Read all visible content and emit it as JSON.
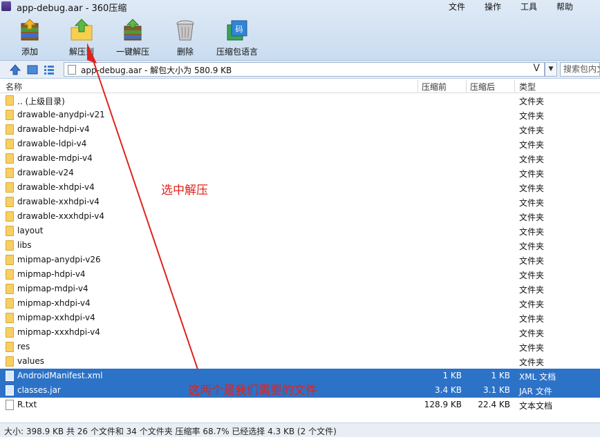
{
  "window": {
    "title": "app-debug.aar - 360压缩",
    "menus": [
      "文件",
      "操作",
      "工具",
      "帮助"
    ]
  },
  "toolbar": [
    {
      "label": "添加",
      "icon": "add-archive-icon"
    },
    {
      "label": "解压到",
      "icon": "extract-to-icon"
    },
    {
      "label": "一键解压",
      "icon": "quick-extract-icon"
    },
    {
      "label": "删除",
      "icon": "trash-icon"
    },
    {
      "label": "压缩包语言",
      "icon": "encoding-icon"
    }
  ],
  "address": {
    "path": "app-debug.aar - 解包大小为 580.9 KB",
    "search_placeholder": "搜索包内文"
  },
  "columns": {
    "name": "名称",
    "compressed": "压缩前",
    "original": "压缩后",
    "type": "类型"
  },
  "rows": [
    {
      "name": ".. (上级目录)",
      "type": "文件夹",
      "kind": "folder"
    },
    {
      "name": "drawable-anydpi-v21",
      "type": "文件夹",
      "kind": "folder"
    },
    {
      "name": "drawable-hdpi-v4",
      "type": "文件夹",
      "kind": "folder"
    },
    {
      "name": "drawable-ldpi-v4",
      "type": "文件夹",
      "kind": "folder"
    },
    {
      "name": "drawable-mdpi-v4",
      "type": "文件夹",
      "kind": "folder"
    },
    {
      "name": "drawable-v24",
      "type": "文件夹",
      "kind": "folder"
    },
    {
      "name": "drawable-xhdpi-v4",
      "type": "文件夹",
      "kind": "folder"
    },
    {
      "name": "drawable-xxhdpi-v4",
      "type": "文件夹",
      "kind": "folder"
    },
    {
      "name": "drawable-xxxhdpi-v4",
      "type": "文件夹",
      "kind": "folder"
    },
    {
      "name": "layout",
      "type": "文件夹",
      "kind": "folder"
    },
    {
      "name": "libs",
      "type": "文件夹",
      "kind": "folder"
    },
    {
      "name": "mipmap-anydpi-v26",
      "type": "文件夹",
      "kind": "folder"
    },
    {
      "name": "mipmap-hdpi-v4",
      "type": "文件夹",
      "kind": "folder"
    },
    {
      "name": "mipmap-mdpi-v4",
      "type": "文件夹",
      "kind": "folder"
    },
    {
      "name": "mipmap-xhdpi-v4",
      "type": "文件夹",
      "kind": "folder"
    },
    {
      "name": "mipmap-xxhdpi-v4",
      "type": "文件夹",
      "kind": "folder"
    },
    {
      "name": "mipmap-xxxhdpi-v4",
      "type": "文件夹",
      "kind": "folder"
    },
    {
      "name": "res",
      "type": "文件夹",
      "kind": "folder"
    },
    {
      "name": "values",
      "type": "文件夹",
      "kind": "folder"
    },
    {
      "name": "AndroidManifest.xml",
      "before": "1 KB",
      "after": "1 KB",
      "type": "XML 文档",
      "kind": "file",
      "selected": true
    },
    {
      "name": "classes.jar",
      "before": "3.4 KB",
      "after": "3.1 KB",
      "type": "JAR 文件",
      "kind": "file",
      "selected": true
    },
    {
      "name": "R.txt",
      "before": "128.9 KB",
      "after": "22.4 KB",
      "type": "文本文档",
      "kind": "file"
    }
  ],
  "status": "大小: 398.9 KB 共 26 个文件和 34 个文件夹 压缩率 68.7% 已经选择 4.3 KB (2 个文件)",
  "annotations": {
    "extract_hint": "选中解压",
    "files_hint": "这两个是我们需要的文件",
    "color": "#e0221b"
  }
}
